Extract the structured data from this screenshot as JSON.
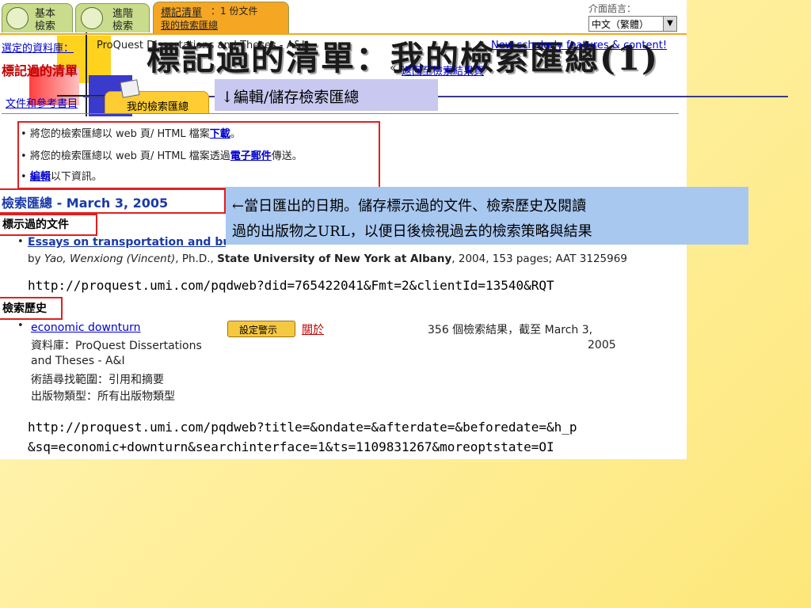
{
  "slide": {
    "title": "標記過的清單：我的檢索匯總(1)"
  },
  "tabs": {
    "basic_line1": "基本",
    "basic_line2": "檢索",
    "advanced_line1": "進階",
    "advanced_line2": "檢索",
    "marked_line1": "標記清單",
    "marked_count": "：1 份文件",
    "marked_line2": "我的檢索匯總"
  },
  "language": {
    "label": "介面語言：",
    "selected": "中文（繁體）"
  },
  "database": {
    "label": "選定的資料庫：",
    "value": "ProQuest Dissertations and Theses - A&I",
    "new_features_link": "New scholarly features & content!"
  },
  "page": {
    "heading": "標記過的清單",
    "back_prefix": "«",
    "back_link": "返回至檢索結果頁"
  },
  "subtabs": {
    "citations": "文件和參考書目",
    "my_summary": "我的檢索匯總"
  },
  "callouts": {
    "edit_save": "↓編輯/儲存檢索匯總",
    "date_line1": "←當日匯出的日期。儲存標示過的文件、檢索歷史及閱讀",
    "date_line2": "過的出版物之URL，以便日後檢視過去的檢索策略與結果"
  },
  "actions": {
    "line1_text": "將您的檢索匯總以 web 頁/ HTML 檔案",
    "line1_link": "下載",
    "line1_end": "。",
    "line2_text": "將您的檢索匯總以 web 頁/ HTML 檔案透過",
    "line2_link": "電子郵件",
    "line2_end": "傳送。",
    "line3_link": "編輯",
    "line3_text": "以下資訊。"
  },
  "summary": {
    "heading": "檢索匯總 - March 3, 2005",
    "marked_docs_label": "標示過的文件",
    "doc_title": "Essays on transportation and business cycles",
    "doc_by": "by ",
    "doc_authors": "Yao, Wenxiong (Vincent)",
    "doc_degree": ", Ph.D., ",
    "doc_school": "State University of New York at Albany",
    "doc_rest": ", 2004, 153 pages; AAT 3125969",
    "doc_url": "http://proquest.umi.com/pqdweb?did=765422041&Fmt=2&clientId=13540&RQT",
    "history_label": "檢索歷史",
    "history_query": "economic downturn",
    "history_set_alert": "設定警示",
    "history_about": "關於",
    "history_results_line1": "356 個檢索結果，截至 March 3,",
    "history_results_line2": "2005",
    "history_db_line1": "資料庫：ProQuest Dissertations",
    "history_db_line2": "and Theses - A&I",
    "history_scope": "術語尋找範圍：引用和摘要",
    "history_pubtype": "出版物類型：所有出版物類型",
    "history_url1": "http://proquest.umi.com/pqdweb?title=&ondate=&afterdate=&beforedate=&h_p",
    "history_url2": "&sq=economic+downturn&searchinterface=1&ts=1109831267&moreoptstate=OI"
  },
  "colors": {
    "tab_active": "#f5a623",
    "tab_inactive": "#c8dc8c",
    "heading_red": "#c00000",
    "summary_blue": "#1a3aa8",
    "callout_blue": "#a8c8f0",
    "callout_lavender": "#c8c8f0",
    "highlight_box": "#e02020"
  }
}
